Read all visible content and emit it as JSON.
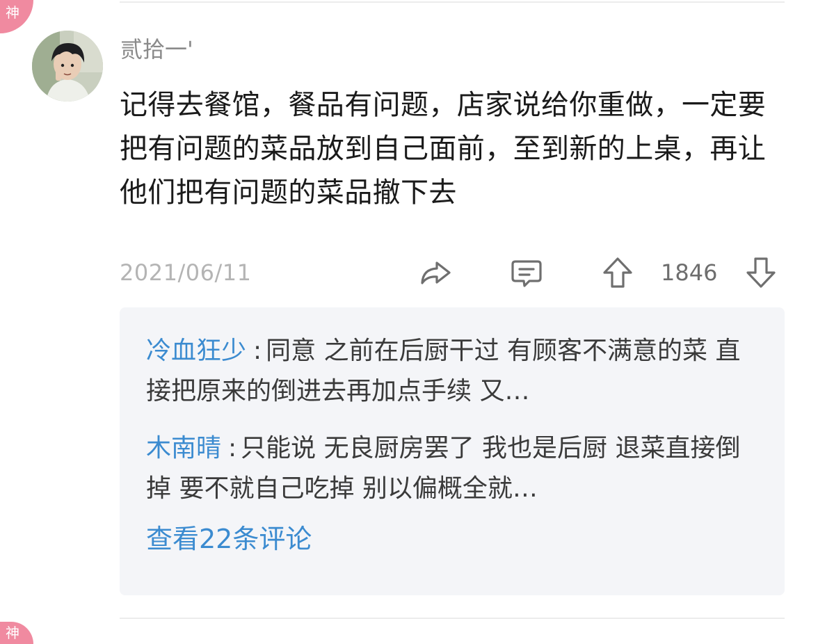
{
  "badges": {
    "god_label": "神"
  },
  "post": {
    "username": "贰拾一'",
    "text": "记得去餐馆，餐品有问题，店家说给你重做，一定要把有问题的菜品放到自己面前，至到新的上桌，再让他们把有问题的菜品撤下去",
    "date": "2021/06/11",
    "votes": "1846"
  },
  "actions": {
    "share_icon": "share-icon",
    "comment_icon": "comment-icon",
    "upvote_icon": "upvote-icon",
    "downvote_icon": "downvote-icon"
  },
  "comments": [
    {
      "author": "冷血狂少",
      "separator": ":",
      "text": "同意 之前在后厨干过 有顾客不满意的菜 直接把原来的倒进去再加点手续 又…"
    },
    {
      "author": "木南晴",
      "separator": ":",
      "text": "只能说 无良厨房罢了 我也是后厨 退菜直接倒掉 要不就自己吃掉 别以偏概全就…"
    }
  ],
  "view_more": "查看22条评论",
  "colors": {
    "accent": "#3b8bd0",
    "badge": "#f08aa0",
    "text": "#1a1a1a",
    "muted": "#b4b4b4"
  }
}
